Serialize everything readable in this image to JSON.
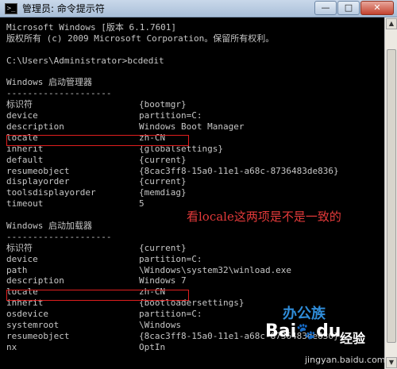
{
  "window": {
    "title": "管理员: 命令提示符",
    "controls": {
      "minimize": "—",
      "maximize": "□",
      "close": "✕"
    }
  },
  "console": {
    "header": [
      "Microsoft Windows [版本 6.1.7601]",
      "版权所有 (c) 2009 Microsoft Corporation。保留所有权利。",
      "",
      "C:\\Users\\Administrator>bcdedit"
    ],
    "section1": {
      "title": "Windows 启动管理器",
      "rule": "--------------------",
      "entries": [
        {
          "key": "标识符",
          "value": "{bootmgr}"
        },
        {
          "key": "device",
          "value": "partition=C:"
        },
        {
          "key": "description",
          "value": "Windows Boot Manager"
        },
        {
          "key": "locale",
          "value": "zh-CN"
        },
        {
          "key": "inherit",
          "value": "{globalsettings}"
        },
        {
          "key": "default",
          "value": "{current}"
        },
        {
          "key": "resumeobject",
          "value": "{8cac3ff8-15a0-11e1-a68c-8736483de836}"
        },
        {
          "key": "displayorder",
          "value": "{current}"
        },
        {
          "key": "toolsdisplayorder",
          "value": "{memdiag}"
        },
        {
          "key": "timeout",
          "value": "5"
        }
      ]
    },
    "section2": {
      "title": "Windows 启动加载器",
      "rule": "--------------------",
      "entries": [
        {
          "key": "标识符",
          "value": "{current}"
        },
        {
          "key": "device",
          "value": "partition=C:"
        },
        {
          "key": "path",
          "value": "\\Windows\\system32\\winload.exe"
        },
        {
          "key": "description",
          "value": "Windows 7"
        },
        {
          "key": "locale",
          "value": "zh-CN"
        },
        {
          "key": "inherit",
          "value": "{bootloadersettings}"
        },
        {
          "key": "osdevice",
          "value": "partition=C:"
        },
        {
          "key": "systemroot",
          "value": "\\Windows"
        },
        {
          "key": "resumeobject",
          "value": "{8cac3ff8-15a0-11e1-a68c-8736483de836}"
        },
        {
          "key": "nx",
          "value": "OptIn"
        }
      ]
    }
  },
  "annotation": {
    "text": "看locale这两项是不是一致的",
    "color": "#e33a3a"
  },
  "highlight_color": "#e01e1e",
  "watermark": {
    "site_logo": "办公族",
    "brand": "Bai",
    "brand_mark": "du",
    "product": "经验",
    "url": "jingyan.baidu.com"
  }
}
